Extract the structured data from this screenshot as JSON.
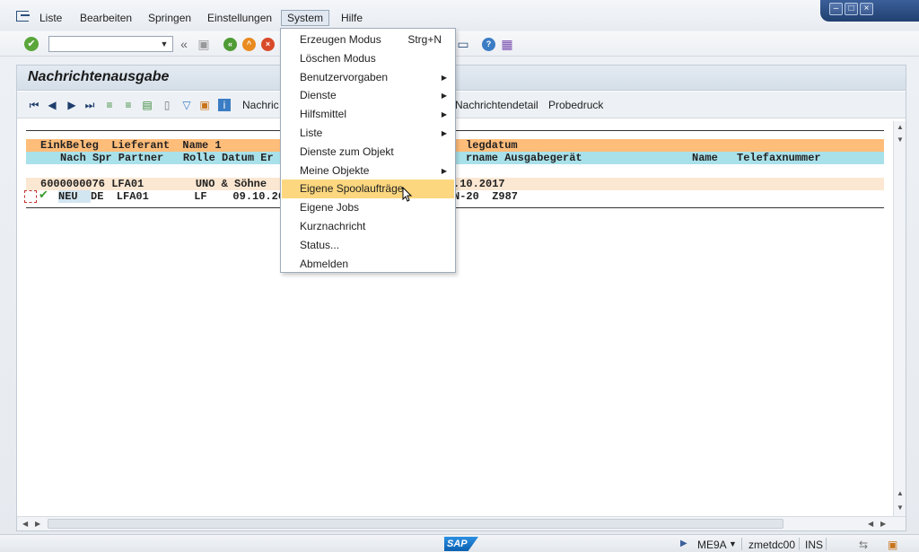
{
  "menubar": {
    "items": [
      {
        "label": "Liste"
      },
      {
        "label": "Bearbeiten"
      },
      {
        "label": "Springen"
      },
      {
        "label": "Einstellungen"
      },
      {
        "label": "System"
      },
      {
        "label": "Hilfe"
      }
    ]
  },
  "toolbar": {
    "command_value": "",
    "icons": [
      "ok-icon",
      "save-icon",
      "back-icon",
      "exit-icon",
      "cancel-icon",
      "layout-icon",
      "help-icon",
      "customize-icon"
    ]
  },
  "panel": {
    "title": "Nachrichtenausgabe",
    "toolbar_labels": [
      "Nachric",
      "Nachrichtendetail",
      "Probedruck"
    ]
  },
  "list": {
    "header1_left": "EinkBeleg  Lieferant  Name 1",
    "header1_right": "legdatum",
    "header2_left": "Nach Spr Partner   Rolle Datum Er",
    "header2_right": "rname Ausgabegerät",
    "header2_name": "Name",
    "header2_fax": "Telefaxnummer",
    "doc_row_left": "6000000076 LFA01        UNO & Söhne",
    "doc_row_right": ".10.2017",
    "msg_status": "NEU",
    "msg_row_left": "DE  LFA01       LF    09.10.20",
    "msg_row_right": "N-20  Z987"
  },
  "system_menu": {
    "items": [
      {
        "label": "Erzeugen Modus",
        "accel": "Strg+N",
        "submenu": false
      },
      {
        "label": "Löschen Modus",
        "accel": "",
        "submenu": false
      },
      {
        "label": "Benutzervorgaben",
        "accel": "",
        "submenu": true
      },
      {
        "label": "Dienste",
        "accel": "",
        "submenu": true
      },
      {
        "label": "Hilfsmittel",
        "accel": "",
        "submenu": true
      },
      {
        "label": "Liste",
        "accel": "",
        "submenu": true
      },
      {
        "label": "Dienste zum Objekt",
        "accel": "",
        "submenu": false
      },
      {
        "label": "Meine Objekte",
        "accel": "",
        "submenu": true
      },
      {
        "label": "Eigene Spoolaufträge",
        "accel": "",
        "submenu": false,
        "highlighted": true
      },
      {
        "label": "Eigene Jobs",
        "accel": "",
        "submenu": false
      },
      {
        "label": "Kurznachricht",
        "accel": "",
        "submenu": false
      },
      {
        "label": "Status...",
        "accel": "",
        "submenu": false
      },
      {
        "label": "Abmelden",
        "accel": "",
        "submenu": false
      }
    ]
  },
  "statusbar": {
    "logo": "SAP",
    "transaction": "ME9A",
    "server": "zmetdc00",
    "mode": "INS"
  },
  "colors": {
    "header1": "#ffbd7a",
    "header2": "#a9e1ea",
    "doc_row": "#fbe7d2",
    "menu_highlight": "#fcd77f"
  }
}
